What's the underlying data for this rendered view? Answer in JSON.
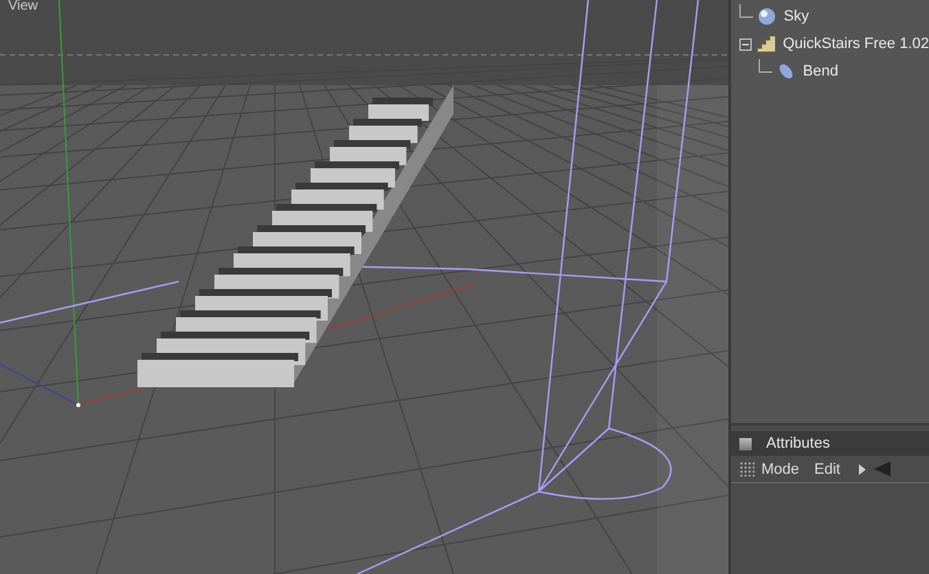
{
  "viewport": {
    "title": "View"
  },
  "objects": [
    {
      "name": "Sky",
      "kind": "sky"
    },
    {
      "name": "QuickStairs Free 1.02",
      "kind": "stairs",
      "expanded": true,
      "children": [
        {
          "name": "Bend",
          "kind": "deformer"
        }
      ]
    }
  ],
  "attributes": {
    "title": "Attributes",
    "menu": [
      "Mode",
      "Edit"
    ]
  }
}
